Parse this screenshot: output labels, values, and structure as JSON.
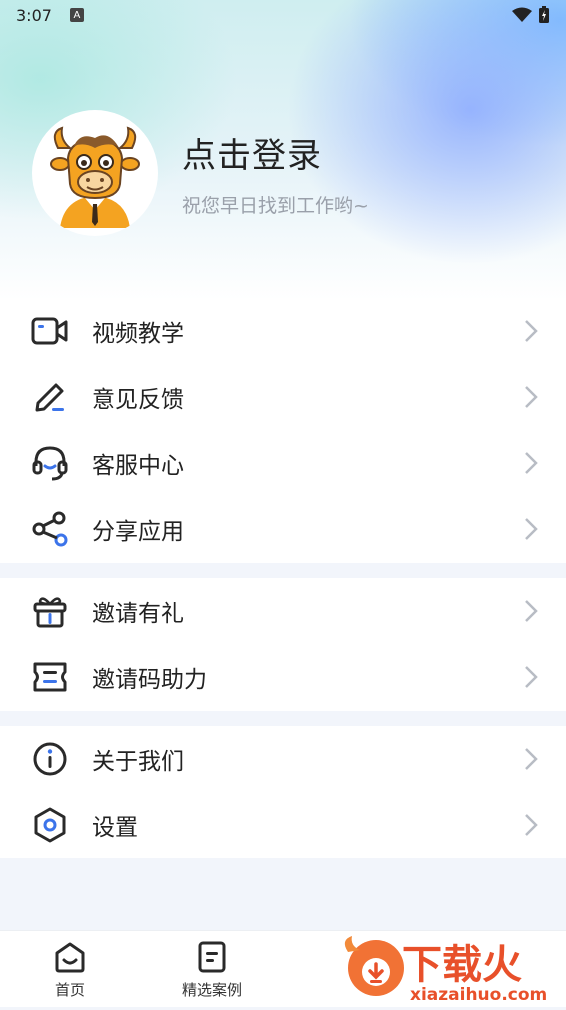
{
  "status": {
    "time": "3:07",
    "notice_badge": "A"
  },
  "profile": {
    "title": "点击登录",
    "subtitle": "祝您早日找到工作哟~"
  },
  "menu_groups": [
    [
      {
        "label": "视频教学",
        "icon": "video-icon"
      },
      {
        "label": "意见反馈",
        "icon": "edit-icon"
      },
      {
        "label": "客服中心",
        "icon": "headset-icon"
      },
      {
        "label": "分享应用",
        "icon": "share-icon"
      }
    ],
    [
      {
        "label": "邀请有礼",
        "icon": "gift-icon"
      },
      {
        "label": "邀请码助力",
        "icon": "ticket-icon"
      }
    ],
    [
      {
        "label": "关于我们",
        "icon": "info-icon"
      },
      {
        "label": "设置",
        "icon": "settings-icon"
      }
    ]
  ],
  "tabbar": [
    {
      "label": "首页",
      "icon": "home-icon"
    },
    {
      "label": "精选案例",
      "icon": "document-icon"
    }
  ],
  "watermark": {
    "brand": "下载火",
    "domain": "xiazaihuo.com"
  },
  "colors": {
    "accent": "#3c74ea",
    "icon_stroke": "#2a2a2a"
  }
}
